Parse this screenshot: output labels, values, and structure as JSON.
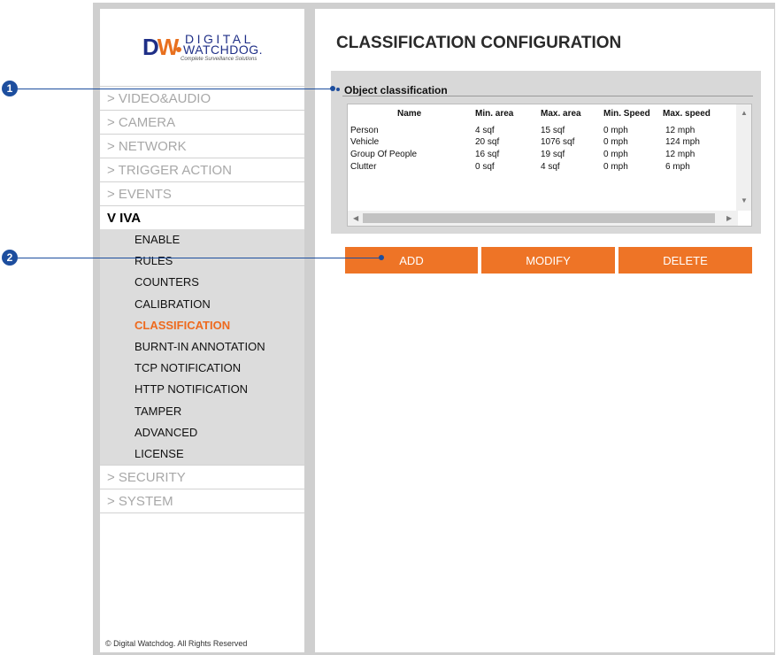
{
  "logo": {
    "mark": "DW",
    "line1": "DIGITAL",
    "line2": "WATCHDOG.",
    "tagline": "Complete Surveillance Solutions"
  },
  "sidebar": {
    "top_items": [
      {
        "label": "> VIDEO&AUDIO"
      },
      {
        "label": "> CAMERA"
      },
      {
        "label": "> NETWORK"
      },
      {
        "label": "> TRIGGER ACTION"
      },
      {
        "label": "> EVENTS"
      }
    ],
    "iva_label": "V IVA",
    "sub_items": [
      {
        "label": "ENABLE"
      },
      {
        "label": "RULES"
      },
      {
        "label": "COUNTERS"
      },
      {
        "label": "CALIBRATION"
      },
      {
        "label": "CLASSIFICATION"
      },
      {
        "label": "BURNT-IN ANNOTATION"
      },
      {
        "label": "TCP NOTIFICATION"
      },
      {
        "label": "HTTP NOTIFICATION"
      },
      {
        "label": "TAMPER"
      },
      {
        "label": "ADVANCED"
      },
      {
        "label": "LICENSE"
      }
    ],
    "active_sub": "CLASSIFICATION",
    "bottom_items": [
      {
        "label": "> SECURITY"
      },
      {
        "label": "> SYSTEM"
      }
    ],
    "copyright": "© Digital Watchdog. All Rights Reserved"
  },
  "main": {
    "page_title": "CLASSIFICATION CONFIGURATION",
    "section_title": "Object classification",
    "table": {
      "columns": [
        "Name",
        "Min. area",
        "Max. area",
        "Min. Speed",
        "Max. speed"
      ],
      "rows": [
        [
          "Person",
          "4 sqf",
          "15 sqf",
          "0 mph",
          "12 mph"
        ],
        [
          "Vehicle",
          "20 sqf",
          "1076 sqf",
          "0 mph",
          "124 mph"
        ],
        [
          "Group Of People",
          "16 sqf",
          "19 sqf",
          "0 mph",
          "12 mph"
        ],
        [
          "Clutter",
          "0 sqf",
          "4 sqf",
          "0 mph",
          "6 mph"
        ]
      ]
    },
    "buttons": {
      "add": "ADD",
      "modify": "MODIFY",
      "delete": "DELETE"
    }
  },
  "callouts": [
    "1",
    "2"
  ],
  "colors": {
    "accent": "#ee7426",
    "active_text": "#ee6a1e",
    "brand_blue": "#1f2f87",
    "callout_blue": "#1d4e9e"
  }
}
